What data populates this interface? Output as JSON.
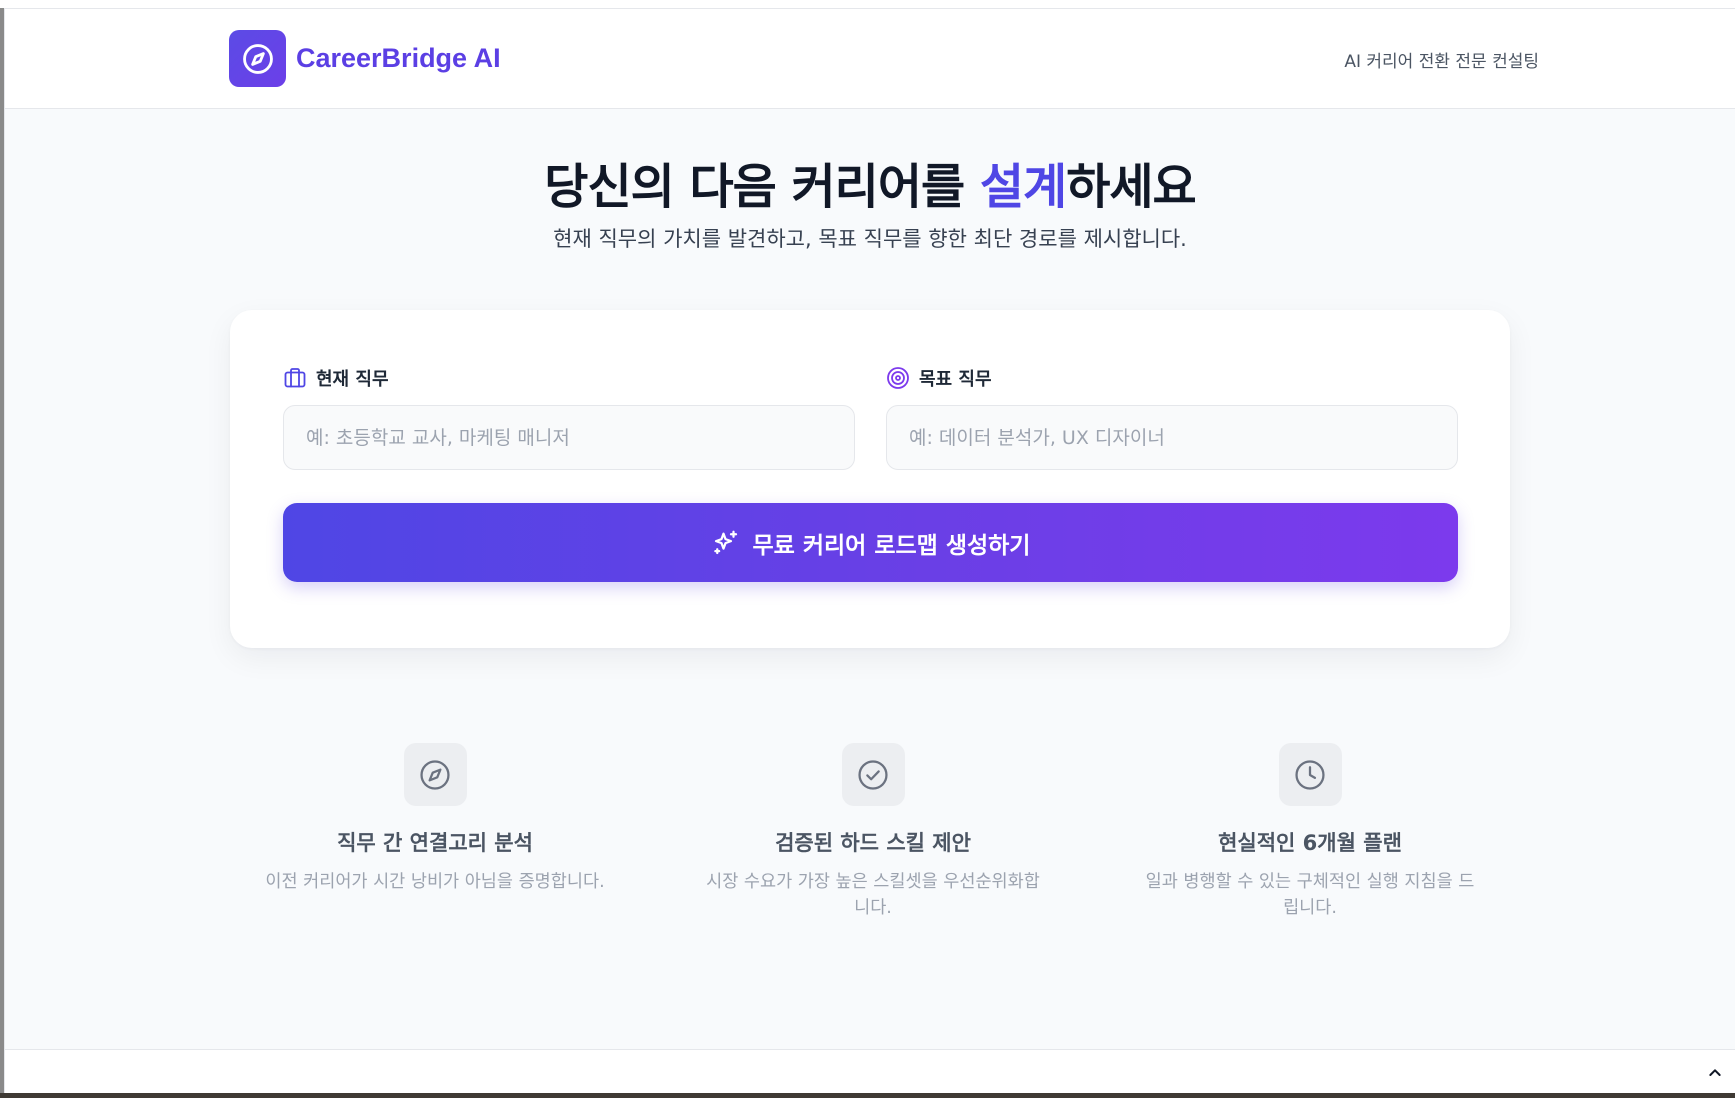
{
  "header": {
    "brand_name": "CareerBridge AI",
    "logo_icon": "compass-icon",
    "tagline": "AI 커리어 전환 전문 컨설팅"
  },
  "hero": {
    "title_before": "당신의 다음 커리어를 ",
    "title_accent": "설계",
    "title_after": "하세요",
    "subtitle": "현재 직무의 가치를 발견하고, 목표 직무를 향한 최단 경로를 제시합니다."
  },
  "form": {
    "current_job": {
      "label": "현재 직무",
      "icon": "briefcase-icon",
      "value": "",
      "placeholder": "예: 초등학교 교사, 마케팅 매니저"
    },
    "target_job": {
      "label": "목표 직무",
      "icon": "target-icon",
      "value": "",
      "placeholder": "예: 데이터 분석가, UX 디자이너"
    },
    "submit": {
      "label": "무료 커리어 로드맵 생성하기",
      "icon": "sparkles-icon"
    }
  },
  "features": [
    {
      "icon": "compass-icon",
      "title": "직무 간 연결고리 분석",
      "description": "이전 커리어가 시간 낭비가 아님을 증명합니다."
    },
    {
      "icon": "check-circle-icon",
      "title": "검증된 하드 스킬 제안",
      "description": "시장 수요가 가장 높은 스킬셋을 우선순위화합니다."
    },
    {
      "icon": "clock-icon",
      "title": "현실적인 6개월 플랜",
      "description": "일과 병행할 수 있는 구체적인 실행 지침을 드립니다."
    }
  ],
  "colors": {
    "brand": "#5b3fe4",
    "accent": "#4f46e5",
    "cta_gradient_start": "#4f46e5",
    "cta_gradient_end": "#7c3aed",
    "page_background": "#f8fafc"
  }
}
